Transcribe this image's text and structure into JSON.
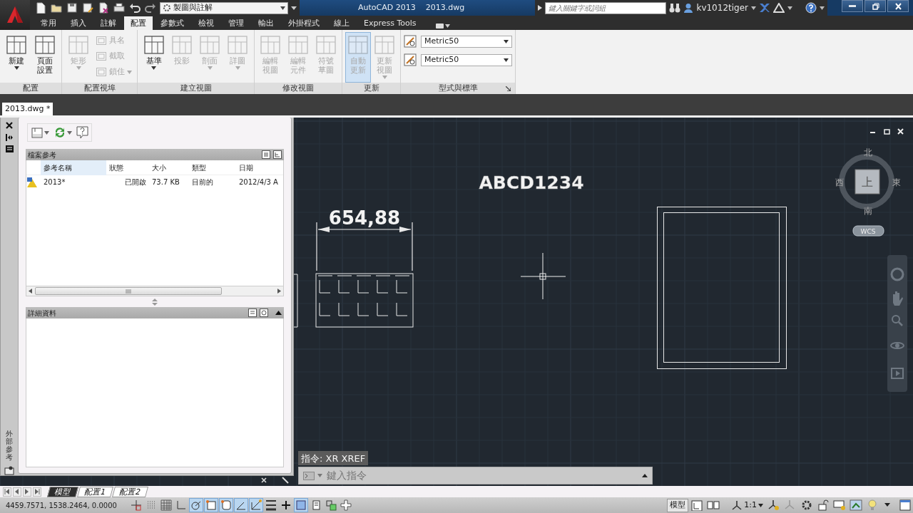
{
  "title_bar": {
    "workspace": "製圖與註解",
    "app_name": "AutoCAD 2013",
    "file_name": "2013.dwg",
    "search": {
      "placeholder": "鍵入關鍵字或詞組"
    },
    "user": "kv1012tiger"
  },
  "ribbon_tabs": [
    {
      "label": "常用",
      "selected": false
    },
    {
      "label": "插入",
      "selected": false
    },
    {
      "label": "註解",
      "selected": false
    },
    {
      "label": "配置",
      "selected": true
    },
    {
      "label": "參數式",
      "selected": false
    },
    {
      "label": "檢視",
      "selected": false
    },
    {
      "label": "管理",
      "selected": false
    },
    {
      "label": "輸出",
      "selected": false
    },
    {
      "label": "外掛程式",
      "selected": false
    },
    {
      "label": "線上",
      "selected": false
    },
    {
      "label": "Express Tools",
      "selected": false
    }
  ],
  "ribbon_panels": [
    {
      "title": "配置",
      "buttons": [
        {
          "kind": "large",
          "label": "新建",
          "disabled": false,
          "dropdown": true,
          "on": false
        },
        {
          "kind": "large",
          "label": "頁面設置",
          "disabled": false,
          "dropdown": false,
          "on": false
        }
      ]
    },
    {
      "title": "配置視埠",
      "buttons": [
        {
          "kind": "large",
          "label": "矩形",
          "disabled": true,
          "dropdown": true,
          "on": false
        },
        {
          "kind": "small",
          "label": "具名",
          "disabled": true,
          "dropdown": false,
          "on": false
        },
        {
          "kind": "small",
          "label": "截取",
          "disabled": true,
          "dropdown": false,
          "on": false
        },
        {
          "kind": "small",
          "label": "鎖住",
          "disabled": true,
          "dropdown": true,
          "on": false
        }
      ]
    },
    {
      "title": "建立視圖",
      "buttons": [
        {
          "kind": "large",
          "label": "基準",
          "disabled": false,
          "dropdown": true,
          "on": false
        },
        {
          "kind": "large",
          "label": "投影",
          "disabled": true,
          "dropdown": false,
          "on": false
        },
        {
          "kind": "large",
          "label": "剖面",
          "disabled": true,
          "dropdown": true,
          "on": false
        },
        {
          "kind": "large",
          "label": "詳圖",
          "disabled": true,
          "dropdown": true,
          "on": false
        }
      ]
    },
    {
      "title": "修改視圖",
      "buttons": [
        {
          "kind": "large",
          "label": "編輯視圖",
          "disabled": true,
          "dropdown": false,
          "on": false
        },
        {
          "kind": "large",
          "label": "編輯元件",
          "disabled": true,
          "dropdown": false,
          "on": false
        },
        {
          "kind": "large",
          "label": "符號草圖",
          "disabled": true,
          "dropdown": false,
          "on": false
        }
      ]
    },
    {
      "title": "更新",
      "buttons": [
        {
          "kind": "large",
          "label": "自動更新",
          "disabled": true,
          "dropdown": false,
          "on": true
        },
        {
          "kind": "large",
          "label": "更新視圖",
          "disabled": true,
          "dropdown": true,
          "on": false
        }
      ]
    },
    {
      "title": "型式與標準",
      "launcher": true,
      "buttons": [
        {
          "kind": "style",
          "label": "Metric50",
          "disabled": false,
          "dropdown": true,
          "on": false
        },
        {
          "kind": "style",
          "label": "Metric50",
          "disabled": false,
          "dropdown": true,
          "on": false
        }
      ]
    }
  ],
  "document_tabs": [
    {
      "label": "2013.dwg *",
      "selected": true
    }
  ],
  "xref_palette": {
    "title": "外部參考",
    "files_section": {
      "title": "檔案參考",
      "columns": [
        {
          "label": "參考名稱",
          "selected": true
        },
        {
          "label": "狀態",
          "selected": false
        },
        {
          "label": "大小",
          "selected": false
        },
        {
          "label": "類型",
          "selected": false
        },
        {
          "label": "日期",
          "selected": false
        }
      ],
      "rows": [
        {
          "cells": [
            "2013*",
            "已開啟",
            "73.7 KB",
            "目前的",
            "2012/4/3 A"
          ]
        }
      ]
    },
    "details_section": {
      "title": "詳細資料"
    }
  },
  "canvas": {
    "text": "ABCD1234",
    "dimension": "654,88",
    "viewcube": {
      "top": "上",
      "north": "北",
      "south": "南",
      "east": "東",
      "west": "西",
      "ucs": "WCS"
    }
  },
  "command_line": {
    "history": "指令: XR XREF",
    "placeholder": "鍵入指令"
  },
  "layout_tabs": [
    {
      "label": "模型",
      "selected": true
    },
    {
      "label": "配置1",
      "selected": false
    },
    {
      "label": "配置2",
      "selected": false
    }
  ],
  "status_bar": {
    "coordinates": "4459.7571, 1538.2464, 0.0000",
    "toggles": [
      {
        "on": false
      },
      {
        "on": false
      },
      {
        "on": false
      },
      {
        "on": false
      },
      {
        "on": true
      },
      {
        "on": true
      },
      {
        "on": true
      },
      {
        "on": true
      },
      {
        "on": true
      },
      {
        "on": false
      },
      {
        "on": false
      },
      {
        "on": true
      },
      {
        "on": false
      },
      {
        "on": false
      },
      {
        "on": false
      }
    ],
    "space": "模型",
    "annotation_scale": "1:1"
  }
}
